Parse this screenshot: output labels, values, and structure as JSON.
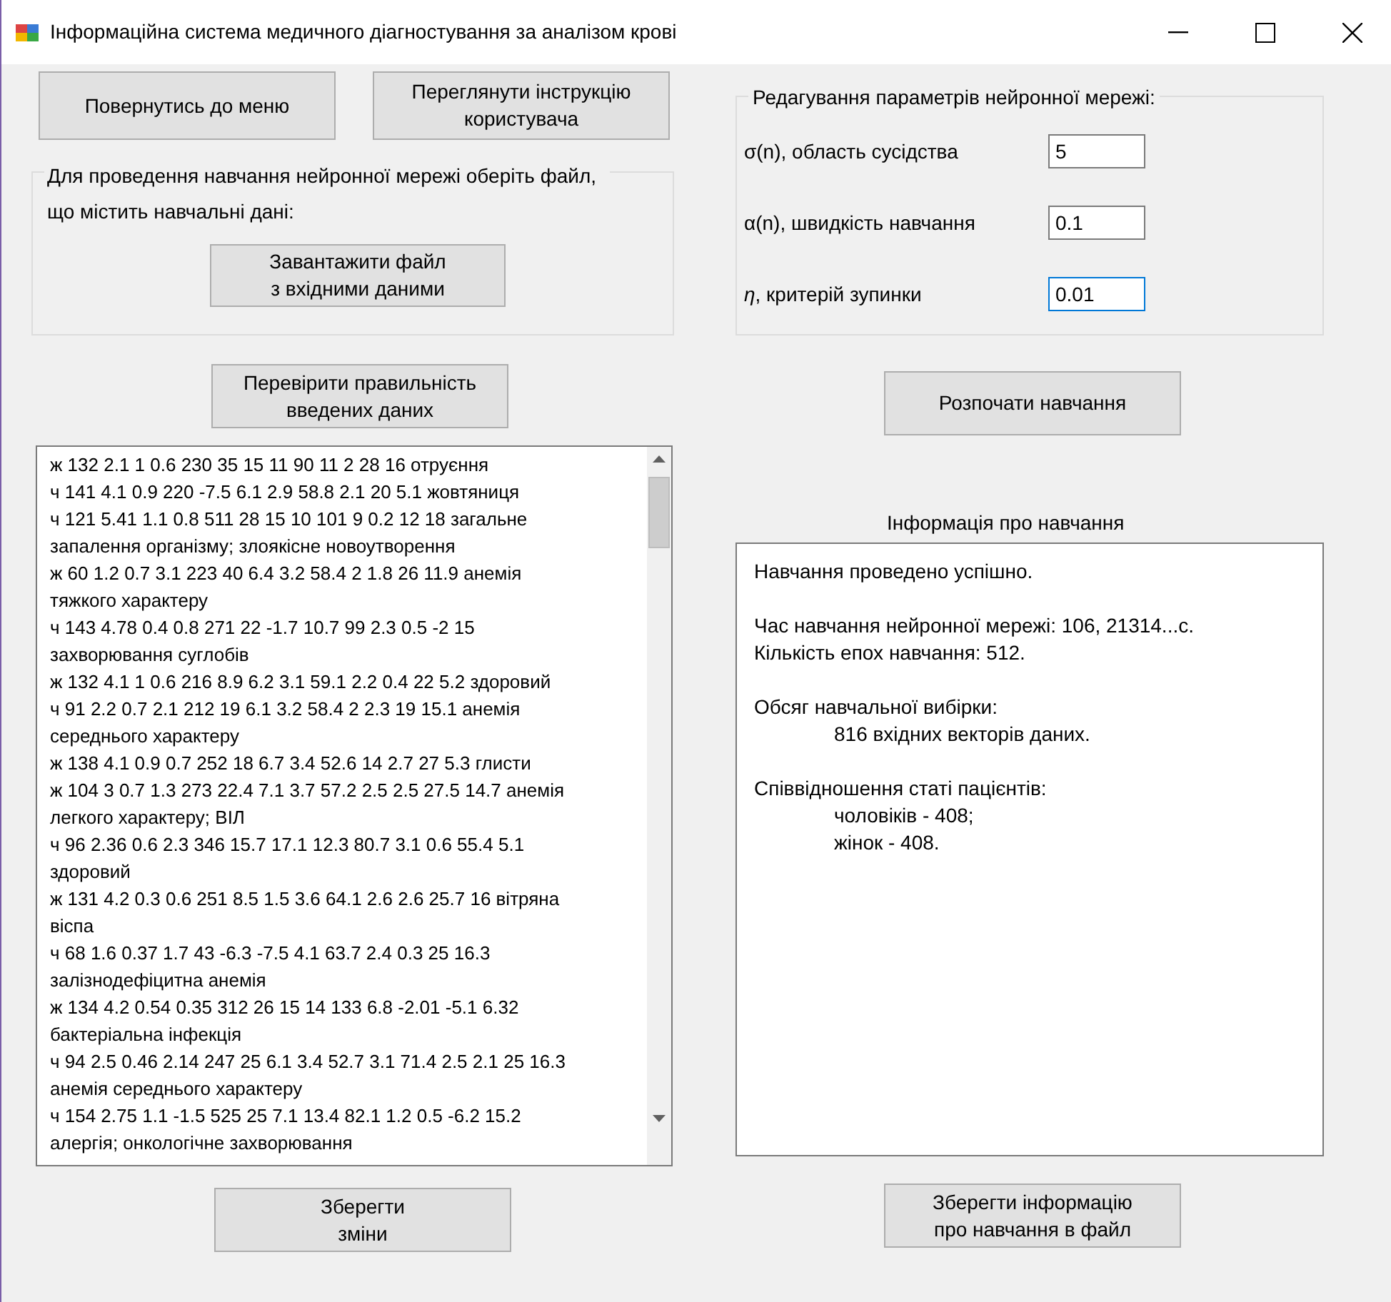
{
  "window": {
    "title": "Інформаційна система медичного діагностування за аналізом крові"
  },
  "top_buttons": [
    "Повернутись до меню",
    "Переглянути інструкцію\nкористувача"
  ],
  "file_group": {
    "text": "Для проведення навчання нейронної мережі оберіть файл, що містить навчальні дані:",
    "button": "Завантажити файл\nз вхідними даними"
  },
  "check_button": "Перевірити правильність\nвведених даних",
  "data_box": {
    "lines": [
      "ж 132 2.1 1 0.6 230 35 15 11 90 11 2 28 16 отруєння",
      "ч 141 4.1 0.9 220 -7.5 6.1 2.9 58.8 2.1 20 5.1 жовтяниця",
      "ч 121 5.41 1.1 0.8 511 28 15 10 101 9 0.2 12 18 загальне",
      "запалення організму; злоякісне новоутворення",
      "ж 60 1.2 0.7 3.1 223 40 6.4 3.2 58.4 2 1.8 26 11.9 анемія",
      "тяжкого характеру",
      "ч 143 4.78 0.4 0.8 271 22 -1.7 10.7 99 2.3 0.5 -2 15",
      "захворювання суглобів",
      "ж 132 4.1 1 0.6 216 8.9 6.2 3.1 59.1 2.2 0.4 22 5.2 здоровий",
      "ч 91 2.2 0.7 2.1 212 19 6.1 3.2 58.4 2 2.3 19 15.1 анемія",
      "середнього характеру",
      "ж 138 4.1 0.9 0.7 252 18 6.7 3.4 52.6 14 2.7 27 5.3 глисти",
      "ж 104 3 0.7 1.3 273 22.4 7.1 3.7 57.2 2.5 2.5 27.5 14.7 анемія",
      "легкого характеру; ВІЛ",
      "ч 96 2.36 0.6 2.3 346 15.7 17.1 12.3 80.7 3.1 0.6 55.4 5.1",
      "здоровий",
      "ж 131 4.2 0.3 0.6 251 8.5 1.5 3.6 64.1 2.6 2.6 25.7 16 вітряна",
      "віспа",
      "ч 68 1.6 0.37 1.7 43 -6.3 -7.5 4.1 63.7 2.4 0.3 25 16.3",
      "залізнодефіцитна анемія",
      "ж 134 4.2 0.54 0.35 312 26 15 14 133 6.8 -2.01 -5.1 6.32",
      "бактеріальна інфекція",
      "ч 94 2.5 0.46 2.14 247 25 6.1 3.4 52.7 3.1 71.4 2.5 2.1 25 16.3",
      "анемія середнього характеру",
      "ч 154 2.75 1.1 -1.5 525 25 7.1 13.4 82.1 1.2 0.5 -6.2 15.2",
      "алергія; онкологічне захворювання"
    ]
  },
  "save_button": "Зберегти\nзміни",
  "params_group": {
    "title": "Редагування параметрів нейронної мережі:",
    "fields": [
      {
        "label": "σ(n), область сусідства",
        "value": "5",
        "focused": false
      },
      {
        "label": "α(n), швидкість навчання",
        "value": "0.1",
        "focused": false
      },
      {
        "label": "*η*, критерій зупинки",
        "value": "0.01",
        "focused": true
      }
    ]
  },
  "start_button": "Розпочати навчання",
  "info": {
    "title": "Інформація про навчання",
    "blocks": [
      {
        "lines": [
          {
            "text": "Навчання проведено успішно.",
            "indented": false
          }
        ]
      },
      {
        "lines": [
          {
            "text": "Час навчання нейронної мережі: 106, 21314...с.",
            "indented": false
          },
          {
            "text": "Кількість епох навчання: 512.",
            "indented": false
          }
        ]
      },
      {
        "lines": [
          {
            "text": "Обсяг навчальної вибірки:",
            "indented": false
          },
          {
            "text": "816 вхідних векторів даних.",
            "indented": true
          }
        ]
      },
      {
        "lines": [
          {
            "text": "Співвідношення статі пацієнтів:",
            "indented": false
          },
          {
            "text": "чоловіків - 408;",
            "indented": true
          },
          {
            "text": "жінок - 408.",
            "indented": true
          }
        ]
      }
    ]
  },
  "save_info_button": "Зберегти інформацію\nпро навчання в файл"
}
